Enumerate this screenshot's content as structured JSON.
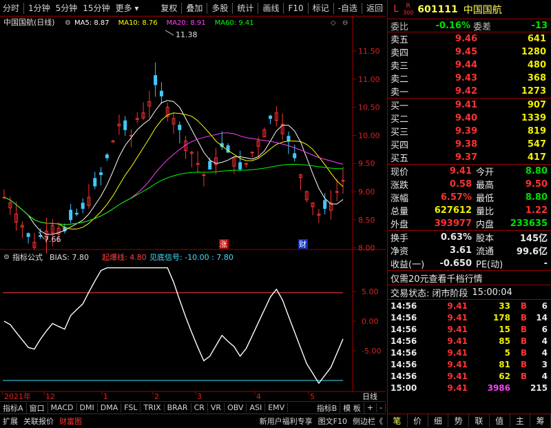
{
  "toolbar": {
    "periods": [
      "分时",
      "1分钟",
      "5分钟",
      "15分钟",
      "更多"
    ],
    "tools": [
      "复权",
      "叠加",
      "多股",
      "统计",
      "画线",
      "F10",
      "标记",
      "-自选",
      "返回"
    ]
  },
  "chart": {
    "title": "中国国航(日线)",
    "ma_labels": [
      {
        "text": "MA5: 8.87",
        "color": "#ffffff"
      },
      {
        "text": "MA10: 8.76",
        "color": "#ffff00"
      },
      {
        "text": "MA20: 8.91",
        "color": "#ff40ff"
      },
      {
        "text": "MA60: 9.41",
        "color": "#00ff00"
      }
    ],
    "high_label": "11.38",
    "low_label": "7.66",
    "marker_up": "涨",
    "marker_fin": "财",
    "price_ticks": [
      "11.50",
      "11.00",
      "10.50",
      "10.00",
      "9.50",
      "9.00",
      "8.50",
      "8.00"
    ],
    "indicator_title": "指标公式",
    "indicator_labels": [
      {
        "text": "BIAS: 7.80",
        "color": "#e0e0e0"
      },
      {
        "text": "起爆线: 4.80",
        "color": "#ff4040"
      },
      {
        "text": "见底信号: -10.00 : 7.80",
        "color": "#40e0ff"
      }
    ],
    "indicator_ticks": [
      "5.00",
      "0.00",
      "-5.00"
    ],
    "date_labels": [
      "2021年",
      "12",
      "1",
      "2",
      "3",
      "4",
      "5"
    ],
    "period_label": "日线"
  },
  "bottom": {
    "row1": [
      "指标A",
      "窗口",
      "MACD",
      "DMI",
      "DMA",
      "FSL",
      "TRIX",
      "BRAR",
      "CR",
      "VR",
      "OBV",
      "ASI",
      "EMV",
      "指标B",
      "模 板",
      "+",
      "-"
    ],
    "row2": [
      "扩展",
      "关联报价",
      "财富图",
      "新用户福利专享",
      "图文F10",
      "侧边栏《"
    ]
  },
  "stock": {
    "lr_top": "L",
    "lr_r": "R",
    "lr_num": "300",
    "code": "601111",
    "name": "中国国航",
    "weibi_label": "委比",
    "weibi": "-0.16%",
    "weicha_label": "委差",
    "weicha": "-13",
    "asks": [
      {
        "label": "卖五",
        "price": "9.46",
        "vol": "641"
      },
      {
        "label": "卖四",
        "price": "9.45",
        "vol": "1280"
      },
      {
        "label": "卖三",
        "price": "9.44",
        "vol": "480"
      },
      {
        "label": "卖二",
        "price": "9.43",
        "vol": "368"
      },
      {
        "label": "卖一",
        "price": "9.42",
        "vol": "1273"
      }
    ],
    "bids": [
      {
        "label": "买一",
        "price": "9.41",
        "vol": "907"
      },
      {
        "label": "买二",
        "price": "9.40",
        "vol": "1339"
      },
      {
        "label": "买三",
        "price": "9.39",
        "vol": "819"
      },
      {
        "label": "买四",
        "price": "9.38",
        "vol": "547"
      },
      {
        "label": "买五",
        "price": "9.37",
        "vol": "417"
      }
    ],
    "stats": [
      {
        "l1": "现价",
        "v1": "9.41",
        "c1": "red",
        "l2": "今开",
        "v2": "8.80",
        "c2": "grn"
      },
      {
        "l1": "涨跌",
        "v1": "0.58",
        "c1": "red",
        "l2": "最高",
        "v2": "9.50",
        "c2": "red"
      },
      {
        "l1": "涨幅",
        "v1": "6.57%",
        "c1": "red",
        "l2": "最低",
        "v2": "8.80",
        "c2": "grn"
      },
      {
        "l1": "总量",
        "v1": "627612",
        "c1": "yel",
        "l2": "量比",
        "v2": "1.22",
        "c2": "red"
      },
      {
        "l1": "外盘",
        "v1": "393977",
        "c1": "red",
        "l2": "内盘",
        "v2": "233635",
        "c2": "grn"
      }
    ],
    "stats2": [
      {
        "l1": "换手",
        "v1": "0.63%",
        "l2": "股本",
        "v2": "145亿"
      },
      {
        "l1": "净资",
        "v1": "3.61",
        "l2": "流通",
        "v2": "99.6亿"
      },
      {
        "l1": "收益(一)",
        "v1": "-0.650",
        "l2": "PE(动)",
        "v2": "-"
      }
    ],
    "promo": "仅需20元查看千档行情",
    "status_label": "交易状态:",
    "status_value": "闭市阶段",
    "status_time": "15:00:04",
    "trades": [
      {
        "t": "14:56",
        "p": "9.41",
        "v": "33",
        "s": "B",
        "n": "6"
      },
      {
        "t": "14:56",
        "p": "9.41",
        "v": "178",
        "s": "B",
        "n": "14"
      },
      {
        "t": "14:56",
        "p": "9.41",
        "v": "15",
        "s": "B",
        "n": "6"
      },
      {
        "t": "14:56",
        "p": "9.41",
        "v": "85",
        "s": "B",
        "n": "4"
      },
      {
        "t": "14:56",
        "p": "9.41",
        "v": "5",
        "s": "B",
        "n": "4"
      },
      {
        "t": "14:56",
        "p": "9.41",
        "v": "81",
        "s": "B",
        "n": "3"
      },
      {
        "t": "14:56",
        "p": "9.41",
        "v": "62",
        "s": "B",
        "n": "4"
      },
      {
        "t": "15:00",
        "p": "9.41",
        "v": "3986",
        "s": "",
        "n": "215"
      }
    ],
    "bottom_tabs": [
      "笔",
      "价",
      "细",
      "势",
      "联",
      "值",
      "主",
      "筹"
    ]
  }
}
